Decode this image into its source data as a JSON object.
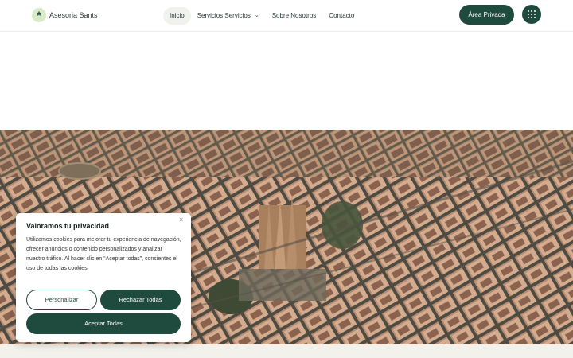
{
  "header": {
    "logo_text": "Asesoria Sants",
    "nav": [
      {
        "label": "Inicio",
        "active": true
      },
      {
        "label": "Servicios Servicios",
        "has_dropdown": true
      },
      {
        "label": "Sobre Nosotros"
      },
      {
        "label": "Contacto"
      }
    ],
    "private_button": "Área Privada",
    "menu_icon": "grid-menu-icon"
  },
  "hero": {
    "image": "aerial view of a city with a cathedral"
  },
  "cookie_dialog": {
    "title": "Valoramos tu privacidad",
    "close": "×",
    "text": "Utilizamos cookies para mejorar tu experiencia de navegación, ofrecer anuncios o contenido personalizados y analizar nuestro tráfico. Al hacer clic en “Aceptar todas”, consientes el uso de todas las cookies.",
    "customize_label": "Personalizar",
    "reject_label": "Rechazar Todas",
    "accept_label": "Aceptar Todas"
  },
  "colors": {
    "brand": "#1f4a3e",
    "logo_bg": "#d7ebc8"
  }
}
